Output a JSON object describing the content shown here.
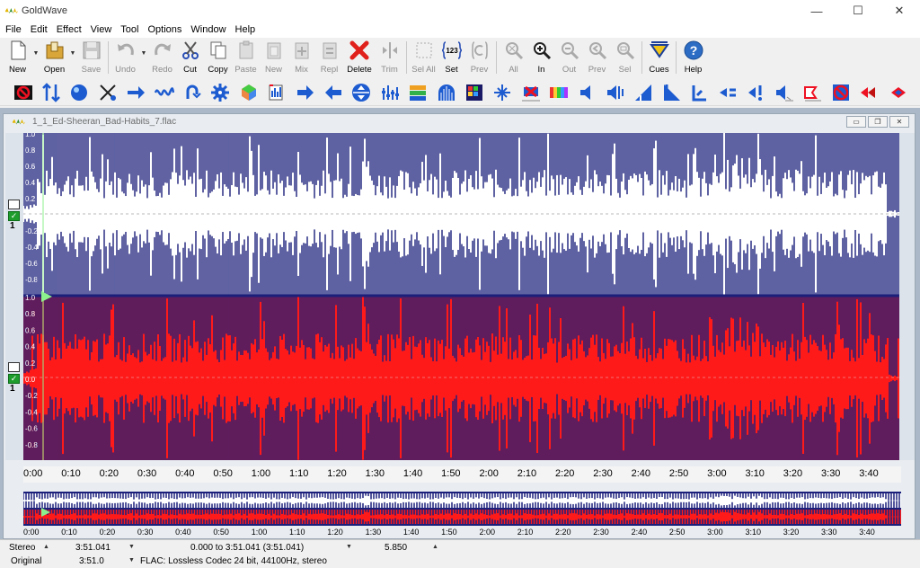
{
  "window": {
    "title": "GoldWave",
    "controls": {
      "minimize": "—",
      "maximize": "☐",
      "close": "✕"
    }
  },
  "menu": [
    "File",
    "Edit",
    "Effect",
    "View",
    "Tool",
    "Options",
    "Window",
    "Help"
  ],
  "toolbar": [
    {
      "label": "New",
      "icon": "new-file-icon",
      "enabled": true
    },
    {
      "label": "Open",
      "icon": "open-folder-icon",
      "enabled": true
    },
    {
      "label": "Save",
      "icon": "save-disk-icon",
      "enabled": false
    },
    {
      "label": "Undo",
      "icon": "undo-icon",
      "enabled": false
    },
    {
      "label": "Redo",
      "icon": "redo-icon",
      "enabled": false
    },
    {
      "label": "Cut",
      "icon": "scissors-icon",
      "enabled": true
    },
    {
      "label": "Copy",
      "icon": "copy-icon",
      "enabled": true
    },
    {
      "label": "Paste",
      "icon": "paste-icon",
      "enabled": false
    },
    {
      "label": "New",
      "icon": "paste-new-icon",
      "enabled": false
    },
    {
      "label": "Mix",
      "icon": "mix-icon",
      "enabled": false
    },
    {
      "label": "Repl",
      "icon": "replace-icon",
      "enabled": false
    },
    {
      "label": "Delete",
      "icon": "delete-x-icon",
      "enabled": true
    },
    {
      "label": "Trim",
      "icon": "trim-icon",
      "enabled": false
    },
    {
      "label": "Sel All",
      "icon": "select-all-icon",
      "enabled": false
    },
    {
      "label": "Set",
      "icon": "set-selection-icon",
      "enabled": true
    },
    {
      "label": "Prev",
      "icon": "previous-selection-icon",
      "enabled": false
    },
    {
      "label": "All",
      "icon": "zoom-all-icon",
      "enabled": false
    },
    {
      "label": "In",
      "icon": "zoom-in-icon",
      "enabled": true
    },
    {
      "label": "Out",
      "icon": "zoom-out-icon",
      "enabled": false
    },
    {
      "label": "Prev",
      "icon": "zoom-previous-icon",
      "enabled": false
    },
    {
      "label": "Sel",
      "icon": "zoom-selection-icon",
      "enabled": false
    },
    {
      "label": "Cues",
      "icon": "cues-icon",
      "enabled": true
    },
    {
      "label": "Help",
      "icon": "help-icon",
      "enabled": true
    }
  ],
  "set_icon_text": "123",
  "effects_toolbar": [
    "stop-effect-icon",
    "doppler-icon",
    "dynamics-icon",
    "echo-icon",
    "fade-in-icon",
    "flanger-icon",
    "invert-icon",
    "mechanize-icon",
    "noise-reduction-icon",
    "offset-icon",
    "pan-icon",
    "playback-rate-icon",
    "reverse-icon",
    "resample-icon",
    "equalizer-icon",
    "spectrum-filter-icon",
    "reverb-icon",
    "pitch-icon",
    "silence-reduction-icon",
    "interpolate-icon",
    "time-warp-icon",
    "volume-icon",
    "volume-shape-icon",
    "fade-up-icon",
    "fade-down-icon",
    "match-volume-icon",
    "change-volume-icon",
    "maximize-volume-icon",
    "shape-volume-icon",
    "compressor-icon",
    "noise-gate-icon",
    "pop-click-icon",
    "auto-cue-icon"
  ],
  "document": {
    "title": "1_1_Ed-Sheeran_Bad-Habits_7.flac",
    "channel_numbers": [
      "1",
      "1"
    ],
    "channels": [
      {
        "name": "left",
        "color": "#ffffff",
        "wave_color": "#1b1f7a"
      },
      {
        "name": "right",
        "color": "#ff1a1a",
        "wave_color": "#1b1f7a"
      }
    ],
    "left_axis_ticks": [
      "1.0",
      "0.8",
      "0.6",
      "0.4",
      "0.2",
      "0.0",
      "-0.2",
      "-0.4",
      "-0.6",
      "-0.8"
    ],
    "right_axis_ticks": [
      "1.0",
      "0.8",
      "0.6",
      "0.4",
      "0.2",
      "0.0",
      "-0.2",
      "-0.4",
      "-0.6",
      "-0.8"
    ],
    "time_labels": [
      "0:00",
      "0:10",
      "0:20",
      "0:30",
      "0:40",
      "0:50",
      "1:00",
      "1:10",
      "1:20",
      "1:30",
      "1:40",
      "1:50",
      "2:00",
      "2:10",
      "2:20",
      "2:30",
      "2:40",
      "2:50",
      "3:00",
      "3:10",
      "3:20",
      "3:30",
      "3:40"
    ],
    "overview_time_labels": [
      "0:00",
      "0:10",
      "0:20",
      "0:30",
      "0:40",
      "0:50",
      "1:00",
      "1:10",
      "1:20",
      "1:30",
      "1:40",
      "1:50",
      "2:00",
      "2:10",
      "2:20",
      "2:30",
      "2:40",
      "2:50",
      "3:00",
      "3:10",
      "3:20",
      "3:30",
      "3:40"
    ]
  },
  "status": {
    "channels": "Stereo",
    "length": "3:51.041",
    "selection": "0.000 to 3:51.041 (3:51.041)",
    "zoom": "5.850",
    "mode": "Original",
    "original_length": "3:51.0",
    "format": "FLAC: Lossless Codec 24 bit, 44100Hz, stereo"
  },
  "colors": {
    "wave_bg_blue": "#1b1f7a",
    "right_channel_red": "#ff1a1a",
    "left_channel_white": "#ffffff",
    "cursor_green": "#8cf08c"
  }
}
